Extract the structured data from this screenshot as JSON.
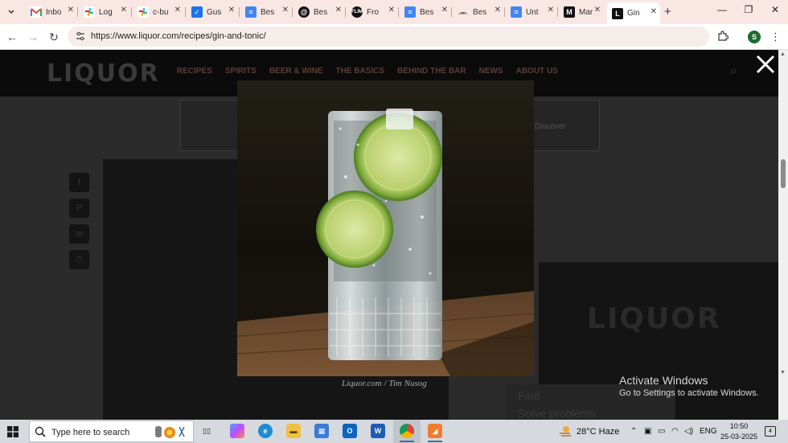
{
  "browser": {
    "tabs": [
      {
        "title": "Inbo",
        "icon": "gmail-icon",
        "color": "#ffffff"
      },
      {
        "title": "Log",
        "icon": "slack-icon",
        "color": "#ffffff"
      },
      {
        "title": "c-bu",
        "icon": "slack-icon",
        "color": "#ffffff"
      },
      {
        "title": "Gus",
        "icon": "checkbox-icon",
        "color": "#1a73e8"
      },
      {
        "title": "Bes",
        "icon": "docs-icon",
        "color": "#4285f4"
      },
      {
        "title": "Bes",
        "icon": "threads-icon",
        "color": "#111111"
      },
      {
        "title": "Fro",
        "icon": "flim-icon",
        "color": "#111111"
      },
      {
        "title": "Bes",
        "icon": "docs-icon",
        "color": "#4285f4"
      },
      {
        "title": "Bes",
        "icon": "bird-icon",
        "color": "#ffffff"
      },
      {
        "title": "Unt",
        "icon": "docs-icon",
        "color": "#4285f4"
      },
      {
        "title": "Mar",
        "icon": "medium-icon",
        "color": "#111111"
      },
      {
        "title": "Gin",
        "icon": "liquor-icon",
        "color": "#111111",
        "active": true
      }
    ],
    "url": "https://www.liquor.com/recipes/gin-and-tonic/",
    "profile_initial": "S"
  },
  "site": {
    "logo": "LIQUOR",
    "nav": [
      "RECIPES",
      "SPIRITS",
      "BEER & WINE",
      "THE BASICS",
      "BEHIND THE BAR",
      "NEWS",
      "ABOUT US"
    ],
    "ad_right_text": "Discover",
    "right_ad_logo": "LIQUOR",
    "bottom_ad_line1": "Find",
    "bottom_ad_line2": "Solve problems"
  },
  "lightbox": {
    "caption": "Liquor.com / Tim Nusog",
    "image_alt": "Gin and tonic in a tall crystal glass with lime wheels"
  },
  "os": {
    "activate_title": "Activate Windows",
    "activate_sub": "Go to Settings to activate Windows.",
    "search_placeholder": "Type here to search",
    "weather": "28°C  Haze",
    "lang": "ENG",
    "time": "10:50",
    "date": "25-03-2025",
    "notifications": "4"
  }
}
